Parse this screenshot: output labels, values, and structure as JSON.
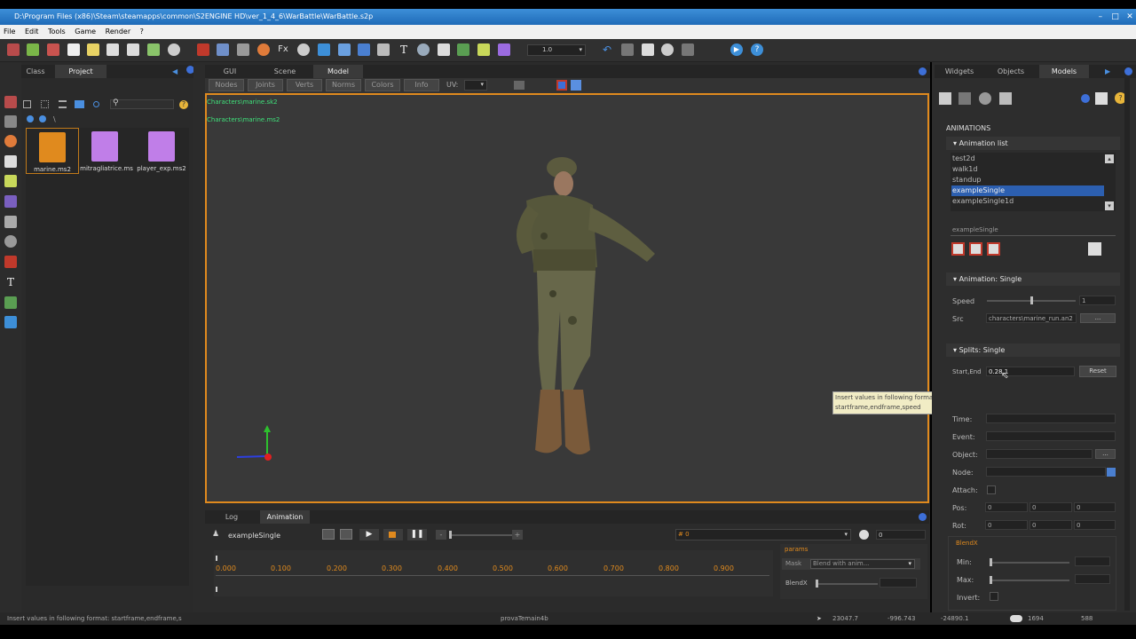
{
  "window": {
    "title": "D:\\Program Files (x86)\\Steam\\steamapps\\common\\S2ENGINE HD\\ver_1_4_6\\WarBattle\\WarBattle.s2p"
  },
  "menu": [
    "File",
    "Edit",
    "Tools",
    "Game",
    "Render",
    "?"
  ],
  "toolbar": {
    "zoom_value": "1.0"
  },
  "left_tabs": [
    "Class",
    "Project"
  ],
  "project": {
    "path": "\\",
    "files": [
      {
        "name": "marine.ms2",
        "color": "#e08a1e"
      },
      {
        "name": "mitragliatrice.ms",
        "color": "#c07ee8"
      },
      {
        "name": "player_exp.ms2",
        "color": "#c07ee8"
      }
    ]
  },
  "center_tabs": [
    "GUI",
    "Scene",
    "Model"
  ],
  "view_buttons": [
    "Nodes",
    "Joints",
    "Verts",
    "Norms",
    "Colors",
    "Info"
  ],
  "uv_label": "UV:",
  "viewport_files": [
    "Characters\\marine.sk2",
    "Characters\\marine.ms2"
  ],
  "bottom_tabs": [
    "Log",
    "Animation"
  ],
  "anim_panel": {
    "name": "exampleSingle",
    "frame_select": "# 0",
    "frame_value": "0",
    "timeline": [
      "0.000",
      "0.100",
      "0.200",
      "0.300",
      "0.400",
      "0.500",
      "0.600",
      "0.700",
      "0.800",
      "0.900"
    ],
    "params_label": "params",
    "mask_label": "Mask",
    "mask_value": "Blend with anim...",
    "blendx_label": "BlendX"
  },
  "right_tabs": [
    "Widgets",
    "Objects",
    "Models"
  ],
  "animations": {
    "section": "ANIMATIONS",
    "list_header": "Animation list",
    "list": [
      "test2d",
      "walk1d",
      "standup",
      "exampleSingle",
      "exampleSingle1d"
    ],
    "selected_index": 3,
    "name_value": "exampleSingle",
    "single_header": "Animation: Single",
    "speed_label": "Speed",
    "speed_value": "1",
    "speed_level": 0.5,
    "src_label": "Src",
    "src_value": "characters\\marine_run.an2",
    "src_button": "...",
    "splits_header": "Splits: Single",
    "startend_label": "Start,End",
    "startend_value": "0.28,1",
    "reset_button": "Reset",
    "event_labels": [
      "Time:",
      "Event:",
      "Object:",
      "Node:",
      "Attach:"
    ],
    "object_button": "...",
    "pos_label": "Pos:",
    "pos": [
      "0",
      "0",
      "0"
    ],
    "rot_label": "Rot:",
    "rot": [
      "0",
      "0",
      "0"
    ],
    "blendx_header": "BlendX",
    "min_label": "Min:",
    "max_label": "Max:",
    "invert_label": "Invert:"
  },
  "tooltip": {
    "line1": "Insert values in following format:",
    "line2": "startframe,endframe,speed"
  },
  "status": {
    "hint": "Insert values in following format: startframe,endframe,s",
    "scene": "provaTemain4b",
    "coords": [
      "23047.7",
      "-996.743",
      "-24890.1"
    ],
    "count1": "1694",
    "count2": "588"
  },
  "colors": {
    "accent": "#e08a1e",
    "selection": "#2c5fb0",
    "file_green": "#3fe07a"
  }
}
